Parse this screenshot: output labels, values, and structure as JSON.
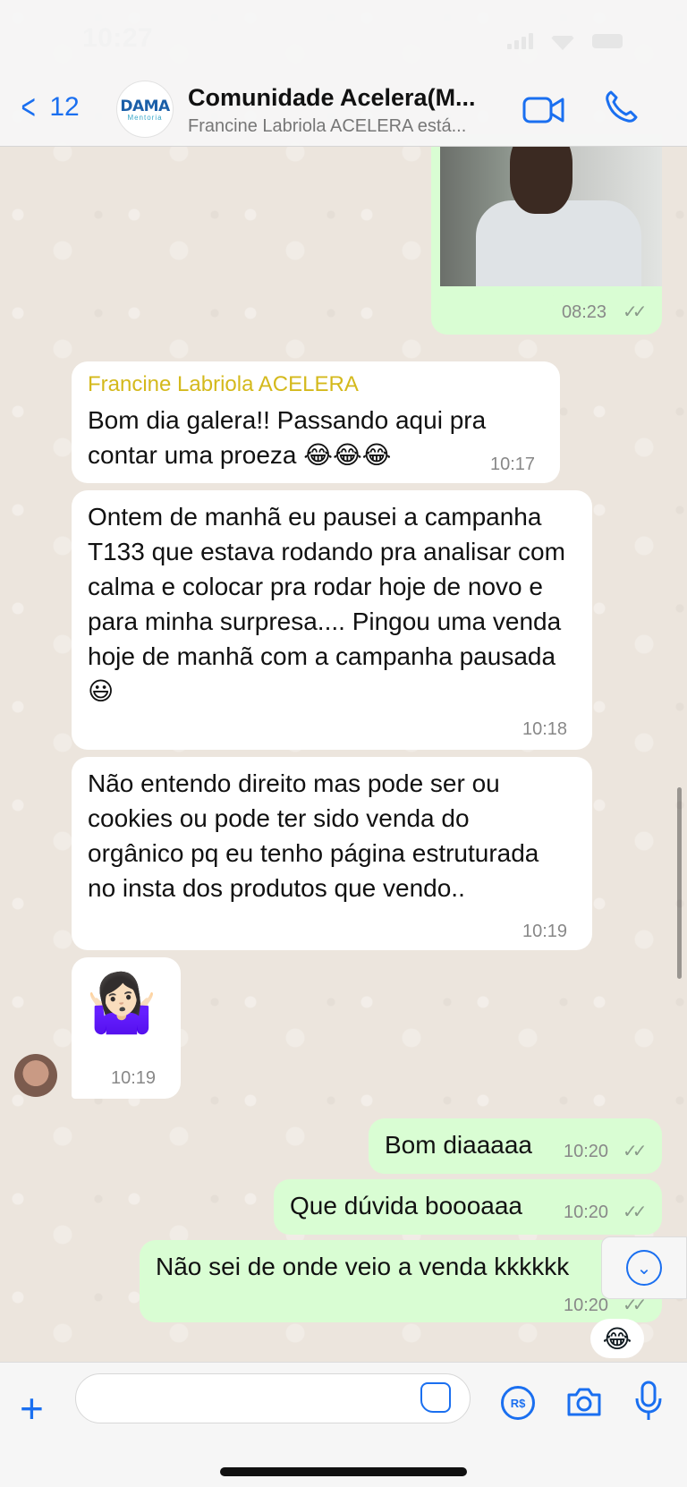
{
  "status_bar": {
    "time": "10:27"
  },
  "header": {
    "back_count": "12",
    "group_avatar_logo": "DAMA",
    "group_avatar_sub": "Mentoria",
    "title": "Comunidade Acelera(M...",
    "subtitle": "Francine Labriola ACELERA está..."
  },
  "messages": [
    {
      "type": "image-outgoing",
      "time": "08:23"
    },
    {
      "type": "incoming",
      "sender": "Francine Labriola ACELERA",
      "text": "Bom dia galera!! Passando aqui pra contar uma proeza 😂😂😂",
      "time": "10:17"
    },
    {
      "type": "incoming",
      "text": "Ontem de manhã eu pausei a campanha T133 que estava rodando pra analisar com calma e colocar pra rodar hoje de novo e para minha surpresa.... Pingou uma venda hoje de manhã com a campanha pausada 😃",
      "time": "10:18"
    },
    {
      "type": "incoming",
      "text": "Não entendo direito mas pode ser ou cookies ou pode ter sido venda do orgânico pq  eu tenho página estruturada no insta dos produtos que vendo..",
      "time": "10:19"
    },
    {
      "type": "incoming-emoji",
      "text": "🤷🏻‍♀️",
      "time": "10:19"
    },
    {
      "type": "outgoing",
      "text": "Bom diaaaaa",
      "time": "10:20"
    },
    {
      "type": "outgoing",
      "text": "Que dúvida boooaaa",
      "time": "10:20"
    },
    {
      "type": "outgoing",
      "text": "Não sei de onde veio a venda kkkkkk",
      "time": "10:20"
    }
  ],
  "reaction": "😂",
  "ticks": "✓✓",
  "input": {
    "placeholder": ""
  },
  "pay_label": "R$"
}
